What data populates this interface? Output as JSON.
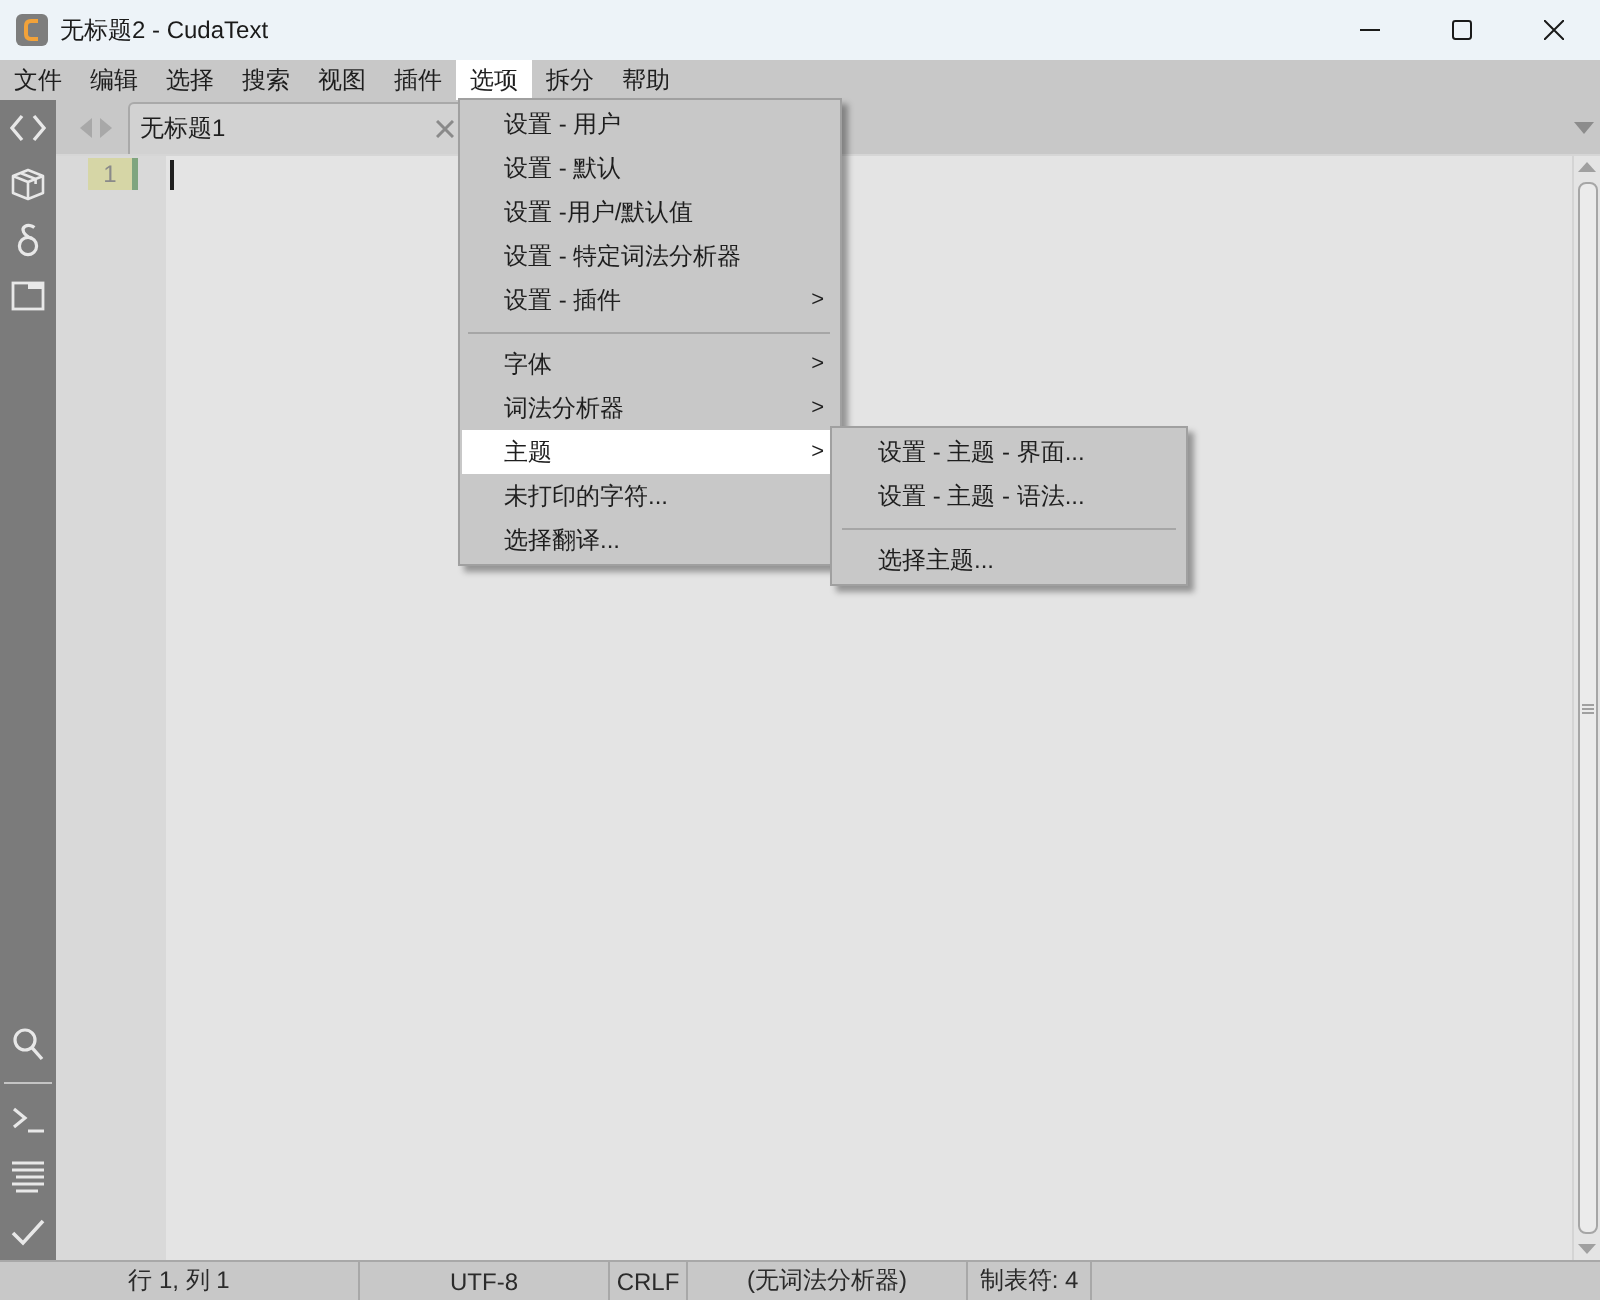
{
  "window": {
    "title": "无标题2 - CudaText"
  },
  "menu_bar": [
    {
      "label": "文件",
      "selected": false
    },
    {
      "label": "编辑",
      "selected": false
    },
    {
      "label": "选择",
      "selected": false
    },
    {
      "label": "搜索",
      "selected": false
    },
    {
      "label": "视图",
      "selected": false
    },
    {
      "label": "插件",
      "selected": false
    },
    {
      "label": "选项",
      "selected": true,
      "menu": {
        "items": [
          {
            "kind": "item",
            "label": "设置 - 用户",
            "selected": false
          },
          {
            "kind": "item",
            "label": "设置 - 默认",
            "selected": false
          },
          {
            "kind": "item",
            "label": "设置 -用户/默认值",
            "selected": false
          },
          {
            "kind": "item",
            "label": "设置 - 特定词法分析器",
            "selected": false
          },
          {
            "kind": "item",
            "label": "设置 - 插件",
            "arrow": ">",
            "selected": false
          },
          {
            "kind": "separator"
          },
          {
            "kind": "item",
            "label": "字体",
            "arrow": ">",
            "selected": false
          },
          {
            "kind": "item",
            "label": "词法分析器",
            "arrow": ">",
            "selected": false
          },
          {
            "kind": "item",
            "label": "主题",
            "arrow": ">",
            "selected": true,
            "submenu": {
              "items": [
                {
                  "kind": "item",
                  "label": "设置 - 主题 - 界面...",
                  "selected": false
                },
                {
                  "kind": "item",
                  "label": "设置 - 主题 - 语法...",
                  "selected": false
                },
                {
                  "kind": "separator"
                },
                {
                  "kind": "item",
                  "label": "选择主题...",
                  "selected": false
                }
              ]
            }
          },
          {
            "kind": "item",
            "label": "未打印的字符...",
            "selected": false
          },
          {
            "kind": "item",
            "label": "选择翻译...",
            "selected": false
          }
        ]
      }
    },
    {
      "label": "拆分",
      "selected": false
    },
    {
      "label": "帮助",
      "selected": false
    }
  ],
  "tabs": [
    {
      "label": "无标题1",
      "selected": true
    }
  ],
  "editor": {
    "lines": [
      {
        "number": "1",
        "current": true
      }
    ]
  },
  "status_bar": {
    "cells": [
      "行 1, 列 1",
      "UTF-8",
      "CRLF",
      "(无词法分析器)",
      "制表符: 4"
    ]
  }
}
